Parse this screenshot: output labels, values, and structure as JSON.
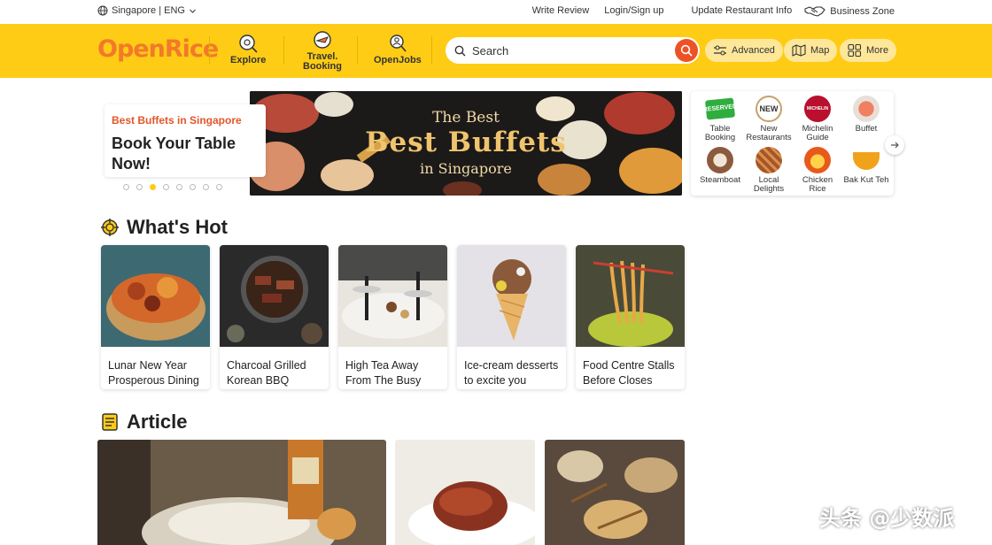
{
  "topbar": {
    "region": "Singapore | ENG",
    "write_review": "Write Review",
    "login": "Login/Sign up",
    "update_info": "Update Restaurant Info",
    "business_zone": "Business Zone"
  },
  "header": {
    "logo": "OpenRice",
    "nav": [
      {
        "label": "Explore",
        "icon": "explore-icon"
      },
      {
        "label_line1": "Travel.",
        "label_line2": "Booking",
        "icon": "travel-booking-icon"
      },
      {
        "label": "OpenJobs",
        "icon": "openjobs-icon"
      }
    ],
    "search_placeholder": "Search",
    "advanced": "Advanced",
    "map": "Map",
    "more": "More",
    "colors": {
      "brand_yellow": "#ffcc15",
      "brand_orange": "#f3792a",
      "search_button": "#ed5224"
    }
  },
  "hero": {
    "kicker": "Best Buffets in Singapore",
    "title": "Book Your Table Now!",
    "banner_line1": "The Best",
    "banner_line2": "Best Buffets",
    "banner_line3": "in Singapore",
    "carousel_count": 8,
    "carousel_active": 3
  },
  "categories": [
    {
      "line1": "Table",
      "line2": "Booking",
      "icon": "reserved-icon",
      "color": "#2fae3e"
    },
    {
      "line1": "New",
      "line2": "Restaurants",
      "icon": "new-badge-icon",
      "color": "#c9a06a"
    },
    {
      "line1": "Michelin",
      "line2": "Guide",
      "icon": "michelin-icon",
      "color": "#b8102e"
    },
    {
      "line1": "Buffet",
      "line2": "",
      "icon": "buffet-icon",
      "color": "#e06040"
    },
    {
      "line1": "Steamboat",
      "line2": "",
      "icon": "steamboat-icon",
      "color": "#8c5a3c"
    },
    {
      "line1": "Local",
      "line2": "Delights",
      "icon": "local-delights-icon",
      "color": "#a4552a"
    },
    {
      "line1": "Chicken",
      "line2": "Rice",
      "icon": "chicken-rice-icon",
      "color": "#e8591c"
    },
    {
      "line1": "Bak Kut Teh",
      "line2": "",
      "icon": "bak-kut-teh-icon",
      "color": "#f0a21a"
    }
  ],
  "whats_hot": {
    "title": "What's Hot",
    "cards": [
      {
        "line1": "Lunar New Year",
        "line2": "Prosperous Dining"
      },
      {
        "line1": "Charcoal Grilled",
        "line2": "Korean BBQ"
      },
      {
        "line1": "High Tea Away",
        "line2": "From The Busy City"
      },
      {
        "line1": "Ice-cream desserts",
        "line2": "to excite you"
      },
      {
        "line1": "Food Centre Stalls",
        "line2": "Before Closes"
      }
    ]
  },
  "article": {
    "title": "Article"
  },
  "watermark": "头条 @少数派"
}
